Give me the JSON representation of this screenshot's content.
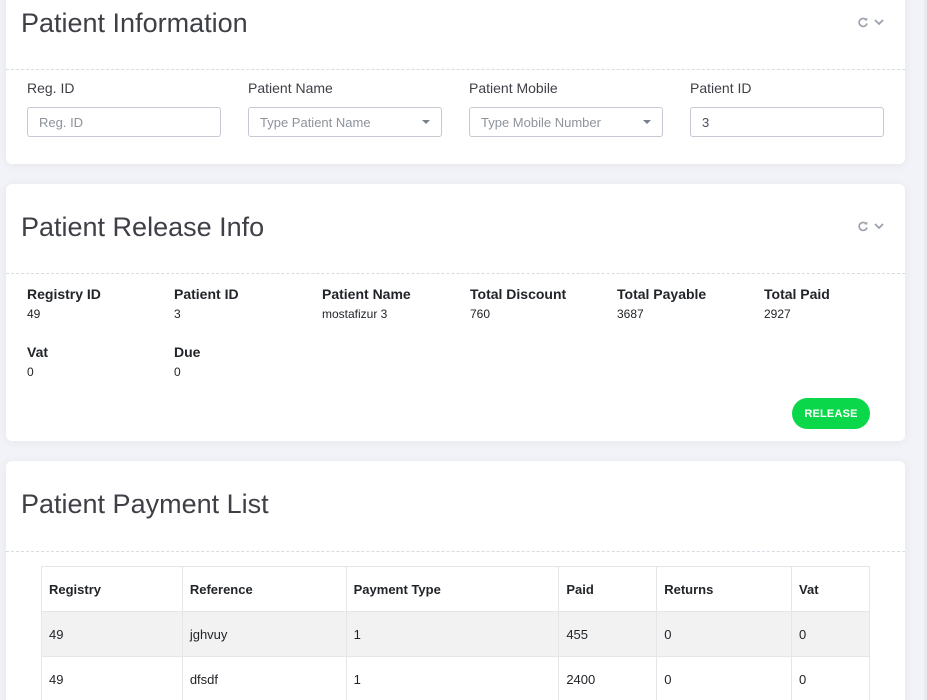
{
  "patient_info": {
    "title": "Patient Information",
    "fields": [
      {
        "label": "Reg. ID",
        "placeholder": "Reg. ID",
        "value": "",
        "type": "input"
      },
      {
        "label": "Patient Name",
        "placeholder": "Type Patient Name",
        "value": "",
        "type": "select"
      },
      {
        "label": "Patient Mobile",
        "placeholder": "Type Mobile Number",
        "value": "",
        "type": "select"
      },
      {
        "label": "Patient ID",
        "placeholder": "",
        "value": "3",
        "type": "input"
      }
    ]
  },
  "release_info": {
    "title": "Patient Release Info",
    "items": [
      {
        "label": "Registry ID",
        "value": "49"
      },
      {
        "label": "Patient ID",
        "value": "3"
      },
      {
        "label": "Patient Name",
        "value": "mostafizur 3"
      },
      {
        "label": "Total Discount",
        "value": "760"
      },
      {
        "label": "Total Payable",
        "value": "3687"
      },
      {
        "label": "Total Paid",
        "value": "2927"
      },
      {
        "label": "Vat",
        "value": "0"
      },
      {
        "label": "Due",
        "value": "0"
      }
    ],
    "release_label": "RELEASE"
  },
  "payment_list": {
    "title": "Patient Payment List",
    "columns": [
      "Registry",
      "Reference",
      "Payment Type",
      "Paid",
      "Returns",
      "Vat"
    ],
    "rows": [
      [
        "49",
        "jghvuy",
        "1",
        "455",
        "0",
        "0"
      ],
      [
        "49",
        "dfsdf",
        "1",
        "2400",
        "0",
        "0"
      ]
    ]
  },
  "icons": {
    "reload": "reload-icon",
    "collapse": "chevron-down-icon"
  },
  "colors": {
    "accent_green": "#0bd74a",
    "title_text": "#3f4047",
    "page_bg": "#f2f3f8"
  }
}
